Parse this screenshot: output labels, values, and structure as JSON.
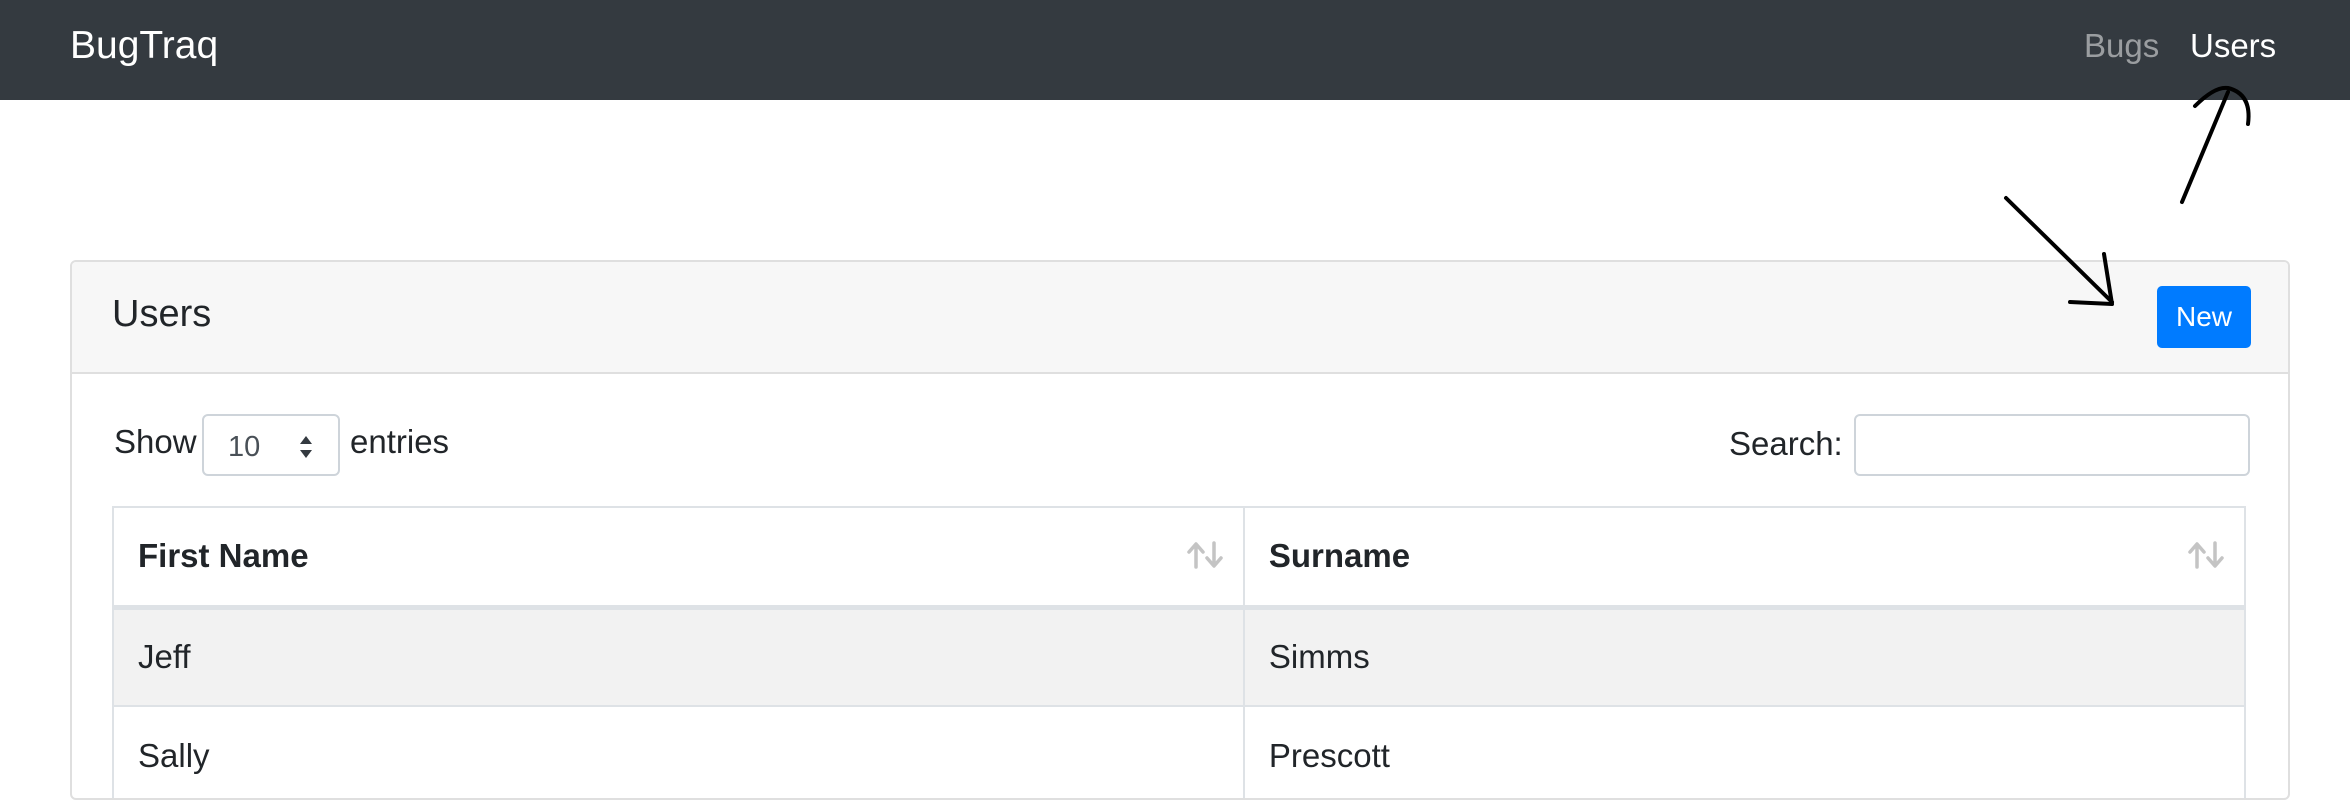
{
  "navbar": {
    "brand": "BugTraq",
    "links": [
      {
        "label": "Bugs",
        "active": false
      },
      {
        "label": "Users",
        "active": true
      }
    ]
  },
  "card": {
    "title": "Users",
    "new_button_label": "New"
  },
  "length_control": {
    "show_label": "Show",
    "selected": "10",
    "entries_label": "entries"
  },
  "search": {
    "label": "Search:",
    "value": "",
    "placeholder": ""
  },
  "table": {
    "columns": [
      "First Name",
      "Surname"
    ],
    "rows": [
      {
        "first_name": "Jeff",
        "surname": "Simms"
      },
      {
        "first_name": "Sally",
        "surname": "Prescott"
      }
    ]
  },
  "colors": {
    "navbar_bg": "#343a40",
    "primary": "#007bff",
    "card_header_bg": "#f7f7f7",
    "stripe": "#f2f2f2"
  },
  "icons": {
    "sort": "sort-icon",
    "select_caret": "chevron-up-down-icon",
    "annotation": "hand-drawn-arrow-icon"
  }
}
